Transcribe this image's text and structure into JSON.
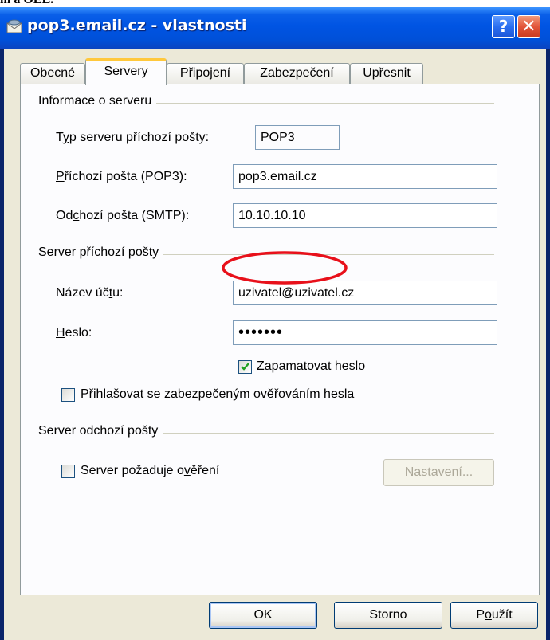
{
  "top_fragment": "m a OEL.",
  "window": {
    "title": "pop3.email.cz - vlastnosti",
    "help_label": "?",
    "close_label": "✕"
  },
  "tabs": [
    {
      "label": "Obecné"
    },
    {
      "label": "Servery"
    },
    {
      "label": "Připojení"
    },
    {
      "label": "Zabezpečení"
    },
    {
      "label": "Upřesnit"
    }
  ],
  "server_info": {
    "group_label": "Informace o serveru",
    "type_label_a": "T",
    "type_label_u": "y",
    "type_label_b": "p serveru příchozí pošty:",
    "type_value": "POP3",
    "incoming_label_u": "P",
    "incoming_label_b": "říchozí pošta (POP3):",
    "incoming_value": "pop3.email.cz",
    "outgoing_label_a": "Od",
    "outgoing_label_u": "c",
    "outgoing_label_b": "hozí pošta (SMTP):",
    "outgoing_value": "10.10.10.10"
  },
  "incoming_server": {
    "group_label": "Server příchozí pošty",
    "account_label_a": "Název úč",
    "account_label_u": "t",
    "account_label_b": "u:",
    "account_value": "uzivatel@uzivatel.cz",
    "password_label_u": "H",
    "password_label_b": "eslo:",
    "password_value": "•••••••",
    "remember_label_u": "Z",
    "remember_label_b": "apamatovat heslo",
    "remember_checked": true,
    "spa_label_a": "Přihlašovat se za",
    "spa_label_u": "b",
    "spa_label_b": "ezpečeným ověřováním hesla",
    "spa_checked": false
  },
  "outgoing_server": {
    "group_label": "Server odchozí pošty",
    "auth_label_a": "Server požaduje o",
    "auth_label_u": "v",
    "auth_label_b": "ěření",
    "auth_checked": false,
    "settings_label_u": "N",
    "settings_label_b": "astavení..."
  },
  "buttons": {
    "ok": "OK",
    "cancel": "Storno",
    "apply_a": "P",
    "apply_u": "o",
    "apply_b": "užít"
  },
  "colors": {
    "titlebar": "#0054e3",
    "face": "#ece9d8",
    "highlight_ellipse": "#e8101a",
    "active_tab_accent": "#ffc83c"
  }
}
